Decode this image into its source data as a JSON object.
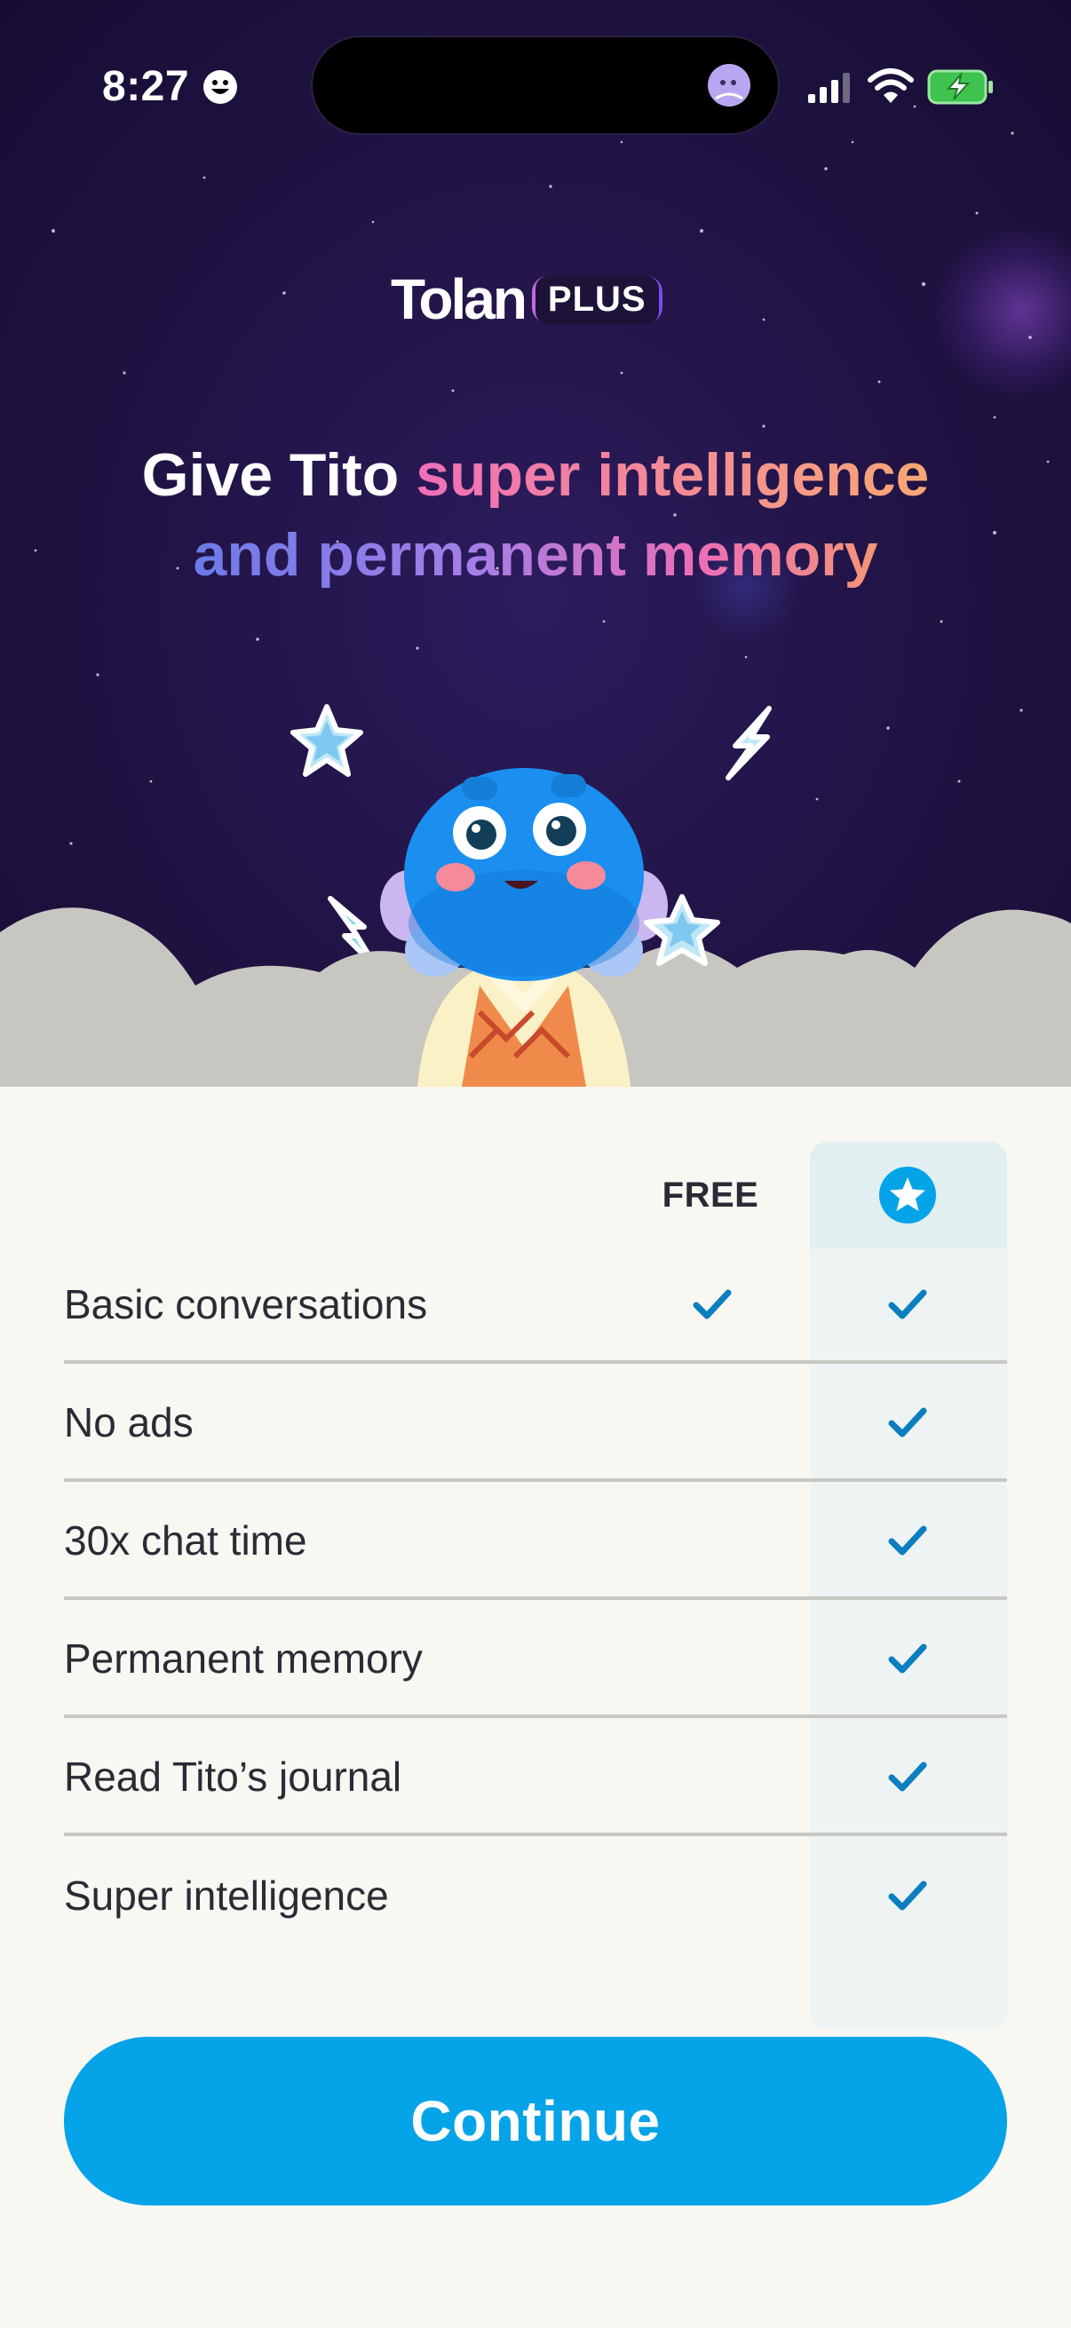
{
  "status_bar": {
    "time": "8:27",
    "icons": [
      "smiley-face-icon",
      "profile-avatar-icon",
      "cellular-signal-icon",
      "wifi-icon",
      "battery-charging-icon"
    ]
  },
  "brand": {
    "name": "Tolan",
    "badge": "PLUS"
  },
  "headline": {
    "part1": "Give Tito ",
    "part2": "super intelligence",
    "part3": "and permanent memory"
  },
  "table": {
    "free_header": "FREE",
    "plus_header_icon": "star-icon",
    "rows": [
      {
        "label": "Basic conversations",
        "free": true,
        "plus": true
      },
      {
        "label": "No ads",
        "free": false,
        "plus": true
      },
      {
        "label": "30x chat time",
        "free": false,
        "plus": true
      },
      {
        "label": "Permanent memory",
        "free": false,
        "plus": true
      },
      {
        "label": "Read Tito’s journal",
        "free": false,
        "plus": true
      },
      {
        "label": "Super intelligence",
        "free": false,
        "plus": true
      }
    ]
  },
  "cta": {
    "label": "Continue"
  },
  "colors": {
    "accent": "#05a3e8",
    "check": "#0b7fbf",
    "hero_bg": "#221447",
    "cloud": "#c8c6c1",
    "page_bg": "#f8f7f2"
  }
}
